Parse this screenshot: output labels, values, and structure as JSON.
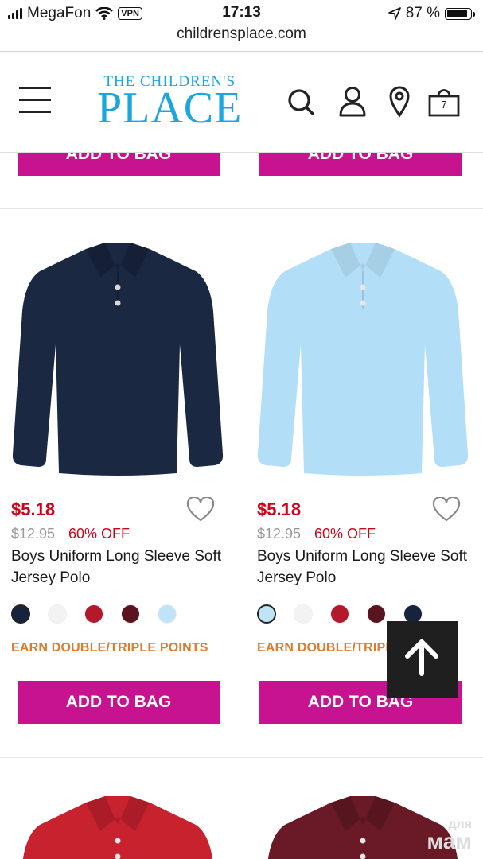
{
  "status": {
    "carrier": "MegaFon",
    "vpn": "VPN",
    "time": "17:13",
    "battery": "87 %"
  },
  "browser": {
    "url": "childrensplace.com"
  },
  "header": {
    "logo_small": "THE CHILDREN'S",
    "logo_big": "PLACE",
    "cart_count": "7"
  },
  "colors": {
    "brand": "#1ba6e0",
    "bag_button": "#c7138f",
    "price": "#d0021b",
    "earn": "#e07b2c"
  },
  "top_row": {
    "left_button": "ADD TO BAG",
    "right_button": "ADD TO BAG"
  },
  "products": [
    {
      "price": "$5.18",
      "was_price": "$12.95",
      "discount": "60% OFF",
      "name": "Boys Uniform Long Sleeve Soft Jersey Polo",
      "shirt_color": "#1a2842",
      "swatches": [
        "#16233d",
        "#f3f3f3",
        "#b3182b",
        "#5a1420",
        "#bfe4f7"
      ],
      "promo": "EARN DOUBLE/TRIPLE POINTS",
      "button": "ADD TO BAG"
    },
    {
      "price": "$5.18",
      "was_price": "$12.95",
      "discount": "60% OFF",
      "name": "Boys Uniform Long Sleeve Soft Jersey Polo",
      "shirt_color": "#b3def7",
      "swatches": [
        "#bfe4f7",
        "#f3f3f3",
        "#b3182b",
        "#5a1420",
        "#16233d"
      ],
      "promo": "EARN DOUBLE/TRIPLE POINTS",
      "button": "ADD TO BAG"
    }
  ],
  "bottom_row": {
    "left_shirt_color": "#c8222e",
    "right_shirt_color": "#6a1a26"
  },
  "watermark": {
    "line1": "для",
    "line2": "мам"
  }
}
